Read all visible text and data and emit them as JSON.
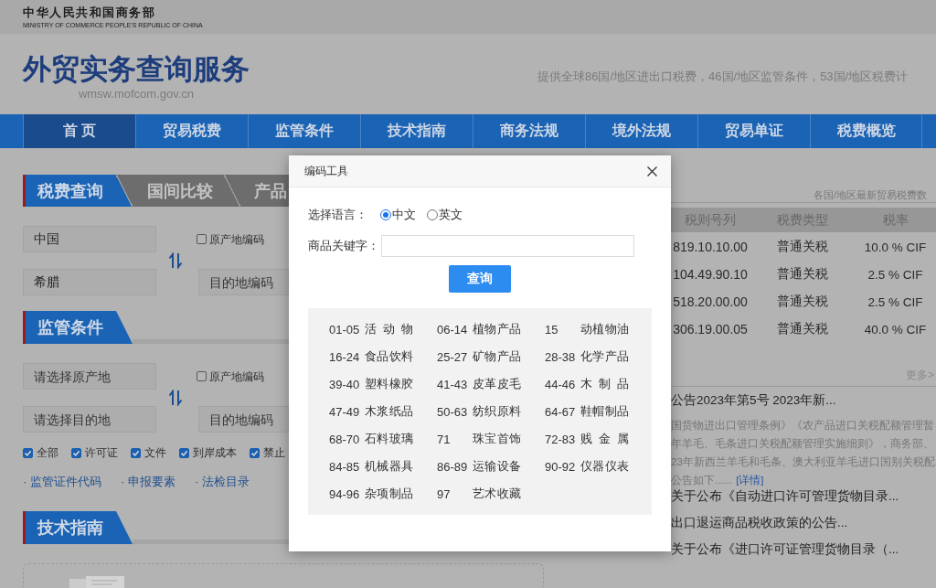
{
  "header": {
    "ministry_name": "中华人民共和国商务部",
    "ministry_name_en": "MINISTRY OF COMMERCE PEOPLE'S REPUBLIC OF CHINA",
    "site_title": "外贸实务查询服务",
    "site_url": "wmsw.mofcom.gov.cn",
    "tagline": "提供全球86国/地区进出口税费，46国/地区监管条件，53国/地区税费计"
  },
  "nav": [
    {
      "label": "首 页",
      "selected": true
    },
    {
      "label": "贸易税费",
      "selected": false
    },
    {
      "label": "监管条件",
      "selected": false
    },
    {
      "label": "技术指南",
      "selected": false
    },
    {
      "label": "商务法规",
      "selected": false
    },
    {
      "label": "境外法规",
      "selected": false
    },
    {
      "label": "贸易单证",
      "selected": false
    },
    {
      "label": "税费概览",
      "selected": false
    }
  ],
  "tariff_query": {
    "tabs": [
      {
        "label": "税费查询",
        "selected": true
      },
      {
        "label": "国间比较",
        "selected": false
      },
      {
        "label": "产品",
        "selected": false
      }
    ],
    "origin": {
      "value": "中国"
    },
    "destination": {
      "value": "希腊"
    },
    "origin_code": {
      "label": "原产地编码",
      "checked": false
    },
    "destination_code": {
      "placeholder": "目的地编码"
    }
  },
  "regulation": {
    "title": "监管条件",
    "origin": {
      "placeholder": "请选择原产地"
    },
    "destination": {
      "placeholder": "请选择目的地"
    },
    "origin_code": {
      "label": "原产地编码",
      "checked": false
    },
    "destination_code": {
      "placeholder": "目的地编码"
    },
    "filters": [
      {
        "label": "全部",
        "checked": true
      },
      {
        "label": "许可证",
        "checked": true
      },
      {
        "label": "文件",
        "checked": true
      },
      {
        "label": "到岸成本",
        "checked": true
      },
      {
        "label": "禁止",
        "checked": true
      }
    ],
    "links": [
      "· 监管证件代码",
      "· 申报要素",
      "· 法检目录"
    ]
  },
  "tech_guide": {
    "title": "技术指南"
  },
  "tariff_table": {
    "caption": "各国/地区最新贸易税费数",
    "columns": [
      "税则号列",
      "税费类型",
      "税率"
    ],
    "rows": [
      [
        "819.10.10.00",
        "普通关税",
        "10.0 % CIF"
      ],
      [
        "104.49.90.10",
        "普通关税",
        "2.5 % CIF"
      ],
      [
        "518.20.00.00",
        "普通关税",
        "2.5 % CIF"
      ],
      [
        "306.19.00.05",
        "普通关税",
        "40.0 % CIF"
      ]
    ],
    "more_link": "更多>"
  },
  "news": {
    "featured_title": "公告2023年第5号 2023年新...",
    "summary_lines": [
      "国货物进出口管理条例》《农产品进口关税配额管理暂",
      "年羊毛、毛条进口关税配额管理实施细则》，商务部、",
      "23年新西兰羊毛和毛条、澳大利亚羊毛进口国别关税配",
      "公告如下......"
    ],
    "details_link": "[详情]",
    "items": [
      "关于公布《自动进口许可管理货物目录...",
      "出口退运商品税收政策的公告...",
      "关于公布《进口许可证管理货物目录（..."
    ]
  },
  "dialog": {
    "title": "编码工具",
    "language_label": "选择语言：",
    "languages": [
      {
        "label": "中文",
        "selected": true
      },
      {
        "label": "英文",
        "selected": false
      }
    ],
    "keyword_label": "商品关键字：",
    "query_button": "查询",
    "chapters": [
      {
        "code": "01-05",
        "name": "活 动 物"
      },
      {
        "code": "06-14",
        "name": "植物产品"
      },
      {
        "code": "15",
        "name": "动植物油"
      },
      {
        "code": "16-24",
        "name": "食品饮料"
      },
      {
        "code": "25-27",
        "name": "矿物产品"
      },
      {
        "code": "28-38",
        "name": "化学产品"
      },
      {
        "code": "39-40",
        "name": "塑料橡胶"
      },
      {
        "code": "41-43",
        "name": "皮革皮毛"
      },
      {
        "code": "44-46",
        "name": "木 制 品"
      },
      {
        "code": "47-49",
        "name": "木浆纸品"
      },
      {
        "code": "50-63",
        "name": "纺织原料"
      },
      {
        "code": "64-67",
        "name": "鞋帽制品"
      },
      {
        "code": "68-70",
        "name": "石料玻璃"
      },
      {
        "code": "71",
        "name": "珠宝首饰"
      },
      {
        "code": "72-83",
        "name": "贱 金 属"
      },
      {
        "code": "84-85",
        "name": "机械器具"
      },
      {
        "code": "86-89",
        "name": "运输设备"
      },
      {
        "code": "90-92",
        "name": "仪器仪表"
      },
      {
        "code": "94-96",
        "name": "杂项制品"
      },
      {
        "code": "97",
        "name": "艺术收藏"
      }
    ]
  }
}
